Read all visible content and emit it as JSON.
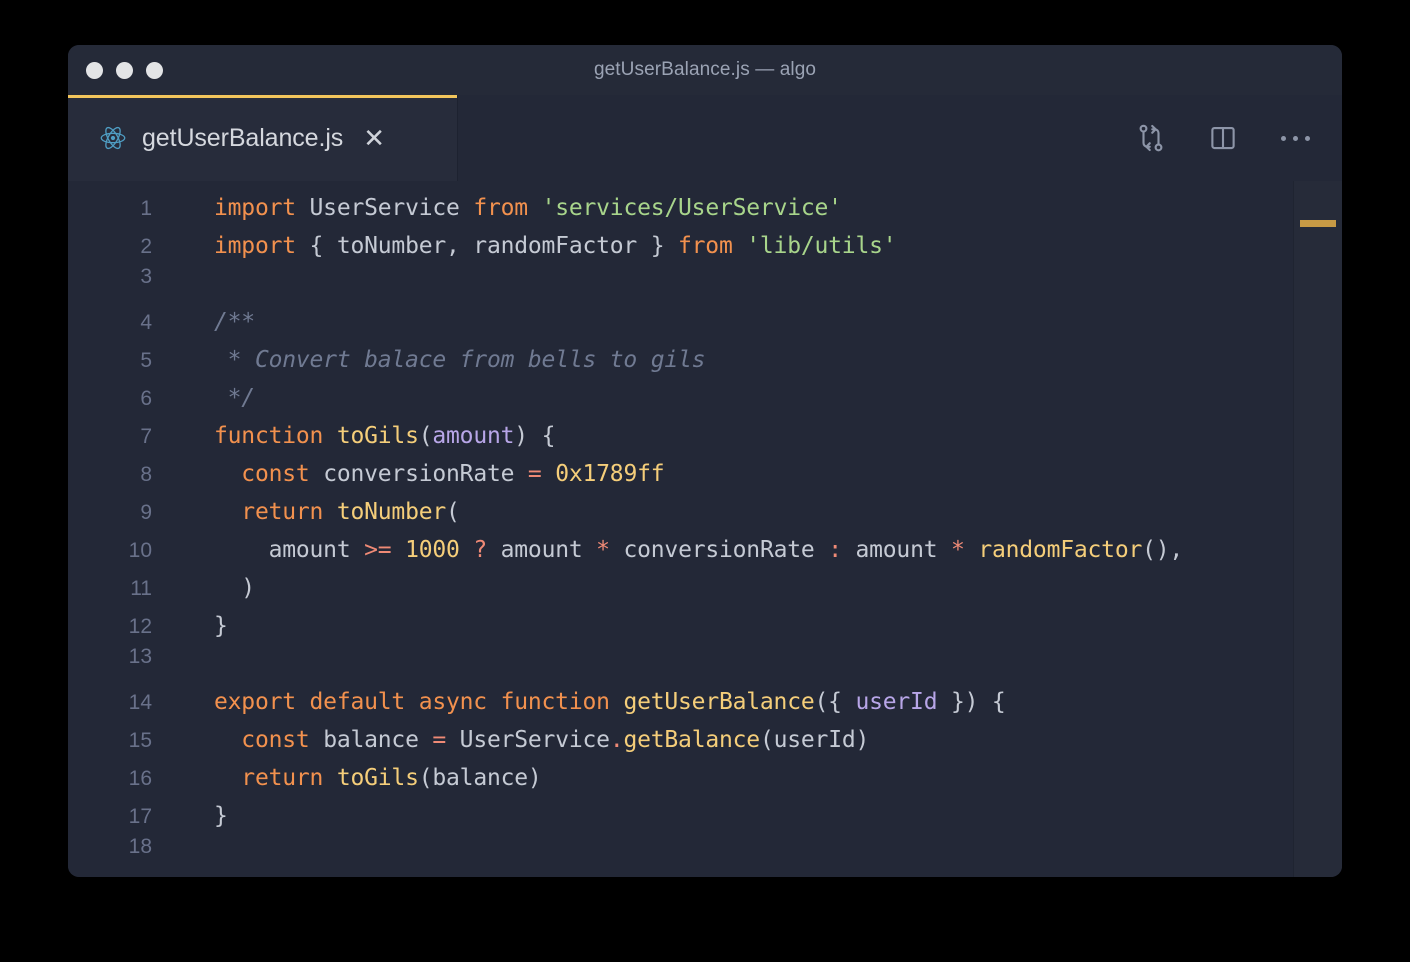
{
  "window": {
    "title": "getUserBalance.js — algo",
    "traffic_lights": [
      "close-dot",
      "minimize-dot",
      "maximize-dot"
    ]
  },
  "tab": {
    "label": "getUserBalance.js",
    "icon": "react-icon",
    "close_label": "✕",
    "active": true,
    "accent_color": "#f2c55c"
  },
  "toolbar": {
    "items": [
      {
        "name": "source-control-compare-icon"
      },
      {
        "name": "split-editor-icon"
      },
      {
        "name": "more-actions-icon"
      }
    ]
  },
  "editor": {
    "language": "javascript",
    "background": "#232837",
    "scrollbar_marker_color": "#c79a45",
    "lines": [
      {
        "n": "1",
        "tokens": [
          {
            "t": "import",
            "c": "kw"
          },
          {
            "t": " UserService ",
            "c": "pl"
          },
          {
            "t": "from",
            "c": "kw"
          },
          {
            "t": " ",
            "c": "pl"
          },
          {
            "t": "'services/UserService'",
            "c": "str"
          }
        ]
      },
      {
        "n": "2",
        "tokens": [
          {
            "t": "import",
            "c": "kw"
          },
          {
            "t": " { toNumber, randomFactor } ",
            "c": "pl"
          },
          {
            "t": "from",
            "c": "kw"
          },
          {
            "t": " ",
            "c": "pl"
          },
          {
            "t": "'lib/utils'",
            "c": "str"
          }
        ]
      },
      {
        "n": "3",
        "tokens": []
      },
      {
        "n": "4",
        "tokens": [
          {
            "t": "/**",
            "c": "cmt"
          }
        ]
      },
      {
        "n": "5",
        "tokens": [
          {
            "t": " * Convert balace from bells to gils",
            "c": "cmt"
          }
        ]
      },
      {
        "n": "6",
        "tokens": [
          {
            "t": " */",
            "c": "cmt"
          }
        ]
      },
      {
        "n": "7",
        "tokens": [
          {
            "t": "function",
            "c": "kw"
          },
          {
            "t": " ",
            "c": "pl"
          },
          {
            "t": "toGils",
            "c": "fn"
          },
          {
            "t": "(",
            "c": "pl"
          },
          {
            "t": "amount",
            "c": "par"
          },
          {
            "t": ") {",
            "c": "pl"
          }
        ]
      },
      {
        "n": "8",
        "tokens": [
          {
            "t": "  ",
            "c": "pl"
          },
          {
            "t": "const",
            "c": "kw"
          },
          {
            "t": " conversionRate ",
            "c": "pl"
          },
          {
            "t": "=",
            "c": "op"
          },
          {
            "t": " ",
            "c": "pl"
          },
          {
            "t": "0x1789ff",
            "c": "num"
          }
        ]
      },
      {
        "n": "9",
        "tokens": [
          {
            "t": "  ",
            "c": "pl"
          },
          {
            "t": "return",
            "c": "kw"
          },
          {
            "t": " ",
            "c": "pl"
          },
          {
            "t": "toNumber",
            "c": "fn"
          },
          {
            "t": "(",
            "c": "pl"
          }
        ]
      },
      {
        "n": "10",
        "tokens": [
          {
            "t": "    amount ",
            "c": "pl"
          },
          {
            "t": ">=",
            "c": "op"
          },
          {
            "t": " ",
            "c": "pl"
          },
          {
            "t": "1000",
            "c": "num"
          },
          {
            "t": " ",
            "c": "pl"
          },
          {
            "t": "?",
            "c": "op"
          },
          {
            "t": " amount ",
            "c": "pl"
          },
          {
            "t": "*",
            "c": "op"
          },
          {
            "t": " conversionRate ",
            "c": "pl"
          },
          {
            "t": ":",
            "c": "op"
          },
          {
            "t": " amount ",
            "c": "pl"
          },
          {
            "t": "*",
            "c": "op"
          },
          {
            "t": " ",
            "c": "pl"
          },
          {
            "t": "randomFactor",
            "c": "fn"
          },
          {
            "t": "(),",
            "c": "pl"
          }
        ]
      },
      {
        "n": "11",
        "tokens": [
          {
            "t": "  )",
            "c": "pl"
          }
        ]
      },
      {
        "n": "12",
        "tokens": [
          {
            "t": "}",
            "c": "pl"
          }
        ]
      },
      {
        "n": "13",
        "tokens": []
      },
      {
        "n": "14",
        "tokens": [
          {
            "t": "export default async function",
            "c": "kw"
          },
          {
            "t": " ",
            "c": "pl"
          },
          {
            "t": "getUserBalance",
            "c": "fn"
          },
          {
            "t": "({ ",
            "c": "pl"
          },
          {
            "t": "userId",
            "c": "par"
          },
          {
            "t": " }) {",
            "c": "pl"
          }
        ]
      },
      {
        "n": "15",
        "tokens": [
          {
            "t": "  ",
            "c": "pl"
          },
          {
            "t": "const",
            "c": "kw"
          },
          {
            "t": " balance ",
            "c": "pl"
          },
          {
            "t": "=",
            "c": "op"
          },
          {
            "t": " UserService",
            "c": "pl"
          },
          {
            "t": ".",
            "c": "op"
          },
          {
            "t": "getBalance",
            "c": "fn"
          },
          {
            "t": "(userId)",
            "c": "pl"
          }
        ]
      },
      {
        "n": "16",
        "tokens": [
          {
            "t": "  ",
            "c": "pl"
          },
          {
            "t": "return",
            "c": "kw"
          },
          {
            "t": " ",
            "c": "pl"
          },
          {
            "t": "toGils",
            "c": "fn"
          },
          {
            "t": "(balance)",
            "c": "pl"
          }
        ]
      },
      {
        "n": "17",
        "tokens": [
          {
            "t": "}",
            "c": "pl"
          }
        ]
      },
      {
        "n": "18",
        "tokens": []
      }
    ]
  }
}
